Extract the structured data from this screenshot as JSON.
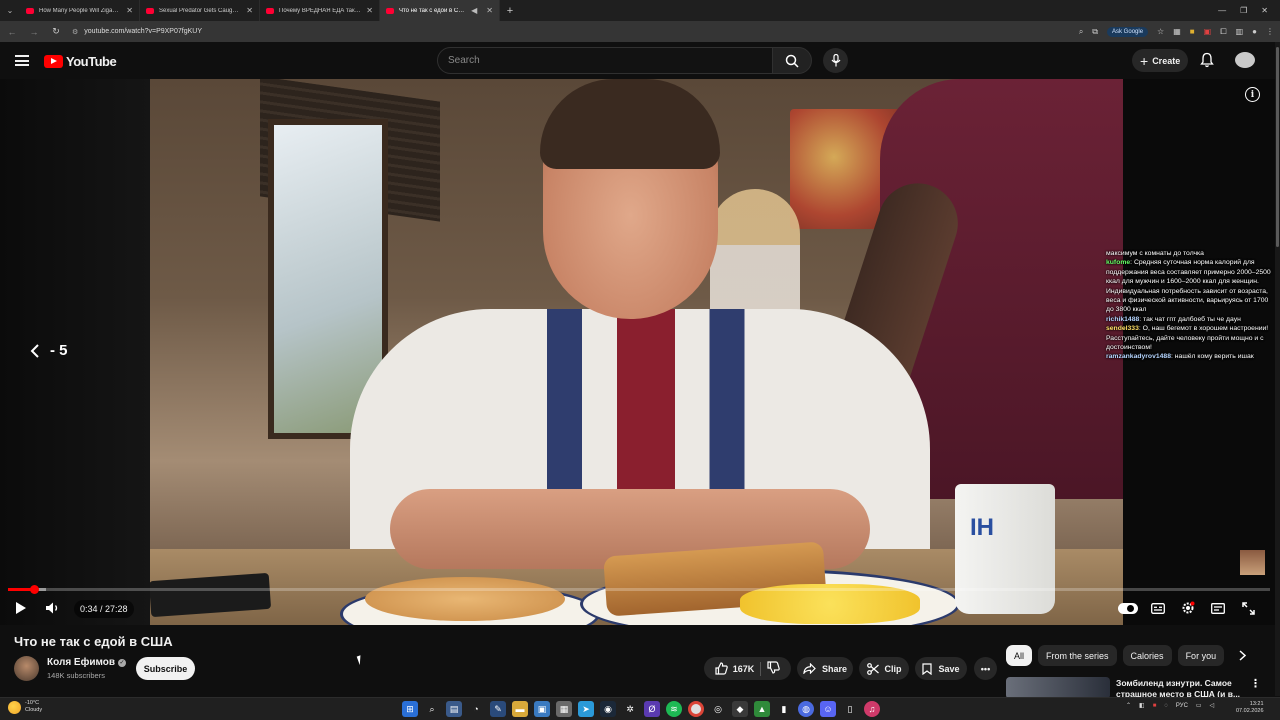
{
  "browser": {
    "tabs": [
      {
        "title": "How Many People Will Zigant Survive?"
      },
      {
        "title": "Sexual Predator Gets Caught in..."
      },
      {
        "title": "Почему ВРЕДНАЯ ЕДА такая В..."
      },
      {
        "title": "Что не так с едой в США",
        "active": true
      }
    ],
    "url": "youtube.com/watch?v=P9XP07fgKUY",
    "ask_google": "Ask Google"
  },
  "youtube": {
    "logo_text": "YouTube",
    "search_placeholder": "Search",
    "create_label": "Create"
  },
  "player": {
    "seek_label": "- 5",
    "time": "0:34 / 27:28",
    "progress_fraction": 0.0206,
    "buffered_fraction": 0.03,
    "chat": [
      {
        "user": "",
        "text": "максимум с комнаты до толчка",
        "color": "#ffffff"
      },
      {
        "user": "kufome",
        "text": "Средняя суточная норма калорий для поддержания веса составляет примерно 2000–2500 ккал для мужчин и 1600–2000 ккал для женщин. Индивидуальная потребность зависит от возраста, веса и физической активности, варьируясь от 1700 до 3800 ккал",
        "color": "#64ff64"
      },
      {
        "user": "richik1488",
        "text": "так чат гпт далбоеб ты че даун",
        "color": "#b5d5ff"
      },
      {
        "user": "sendel333",
        "text": "О, наш бегемот в хорошем настроении! Расступайтесь, дайте человеку пройти мощно и с достоинством!",
        "color": "#ffe066"
      },
      {
        "user": "ramzankadyrov1488",
        "text": "нашёл кому верить ишак",
        "color": "#b5d5ff"
      }
    ]
  },
  "video": {
    "title": "Что не так с едой в США",
    "channel_name": "Коля Ефимов",
    "subscribers": "148K subscribers",
    "subscribe_label": "Subscribe",
    "likes": "167K",
    "share_label": "Share",
    "clip_label": "Clip",
    "save_label": "Save"
  },
  "sidebar": {
    "chips": [
      "All",
      "From the series",
      "Calories",
      "For you"
    ],
    "recommendation_title": "Зомбиленд изнутри. Самое страшное место в США (и в..."
  },
  "taskbar": {
    "weather_temp": "-10°C",
    "weather_desc": "Cloudy",
    "lang": "РУС",
    "time": "13:21",
    "date": "07.02.2026"
  },
  "colors": {
    "accent": "#ff0000",
    "background": "#0f0f0f"
  }
}
